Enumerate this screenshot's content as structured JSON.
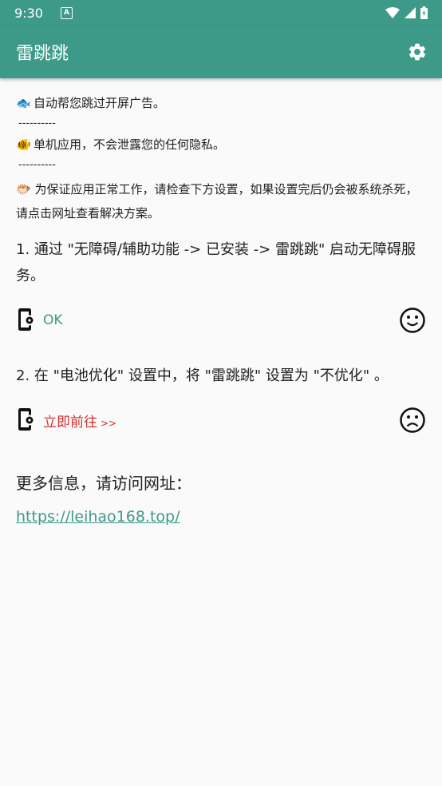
{
  "status_bar": {
    "time": "9:30",
    "notif_letter": "A"
  },
  "app_bar": {
    "title": "雷跳跳"
  },
  "intro": {
    "line1": {
      "emoji": "🐟",
      "text": "自动帮您跳过开屏广告。"
    },
    "separator1": "----------",
    "line2": {
      "emoji": "🐠",
      "text": "单机应用，不会泄露您的任何隐私。"
    },
    "separator2": "----------",
    "line3": {
      "emoji": "🐡",
      "text": "为保证应用正常工作，请检查下方设置，如果设置完后仍会被系统杀死，请点击网址查看解决方案。"
    }
  },
  "step1": {
    "text": "1. 通过 \"无障碍/辅助功能 -> 已安装 -> 雷跳跳\" 启动无障碍服务。",
    "status_label": "OK",
    "status": "ok"
  },
  "step2": {
    "text": "2. 在 \"电池优化\" 设置中，将 \"雷跳跳\" 设置为 \"不优化\" 。",
    "action_label": "立即前往",
    "action_arrow": ">>",
    "status": "not-ok"
  },
  "more_info": {
    "label": "更多信息，请访问网址：",
    "url": "https://leihao168.top/"
  },
  "colors": {
    "primary": "#3d9a88",
    "warning": "#d32f2f"
  }
}
